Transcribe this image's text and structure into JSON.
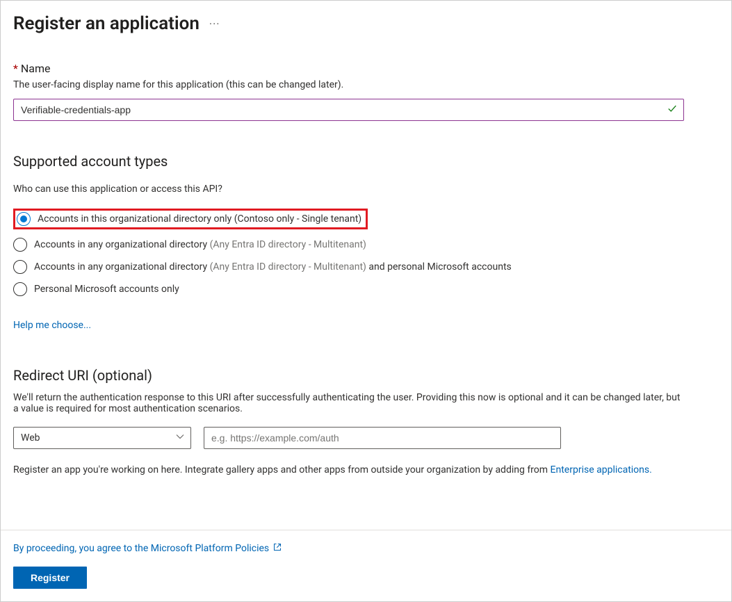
{
  "header": {
    "title": "Register an application"
  },
  "name_section": {
    "label": "Name",
    "description": "The user-facing display name for this application (this can be changed later).",
    "value": "Verifiable-credentials-app"
  },
  "account_types": {
    "heading": "Supported account types",
    "sub": "Who can use this application or access this API?",
    "options": [
      {
        "label": "Accounts in this organizational directory only (Contoso only - Single tenant)",
        "selected": true,
        "highlighted": true
      },
      {
        "label_main": "Accounts in any organizational directory",
        "label_suffix": "(Any Entra ID directory - Multitenant)",
        "selected": false
      },
      {
        "label_main": "Accounts in any organizational directory",
        "label_suffix": "(Any Entra ID directory - Multitenant)",
        "label_tail": " and personal Microsoft accounts",
        "selected": false
      },
      {
        "label": "Personal Microsoft accounts only",
        "selected": false
      }
    ],
    "help_link": "Help me choose..."
  },
  "redirect": {
    "heading": "Redirect URI (optional)",
    "description": "We'll return the authentication response to this URI after successfully authenticating the user. Providing this now is optional and it can be changed later, but a value is required for most authentication scenarios.",
    "platform_selected": "Web",
    "uri_placeholder": "e.g. https://example.com/auth"
  },
  "footer_info": {
    "text_prefix": "Register an app you're working on here. Integrate gallery apps and other apps from outside your organization by adding from ",
    "link_text": "Enterprise applications."
  },
  "proceed": {
    "text": "By proceeding, you agree to the Microsoft Platform Policies"
  },
  "register_button": "Register"
}
